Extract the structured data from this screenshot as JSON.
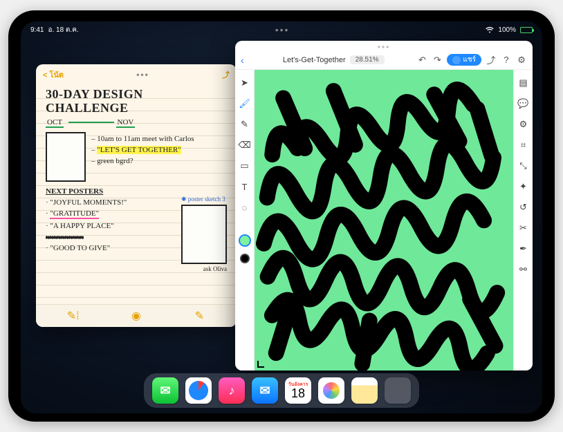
{
  "status": {
    "time": "9:41",
    "date": "อ. 18 ต.ค.",
    "battery_pct": "100%"
  },
  "notes": {
    "header": {
      "title": "โน้ต"
    },
    "title_line1": "30-DAY DESIGN",
    "title_line2": "CHALLENGE",
    "month_from": "OCT",
    "month_to": "NOV",
    "bullets1": {
      "a": "10am to 11am meet with Carlos",
      "b": "\"LET'S GET TOGETHER\"",
      "c": "green bgrd?"
    },
    "heading_next": "NEXT POSTERS",
    "list": {
      "a": "\"JOYFUL MOMENTS!\"",
      "b": "\"GRATITUDE\"",
      "c": "\"A HAPPY PLACE\"",
      "d": "xxxxxxxxxx",
      "e": "\"GOOD TO GIVE\""
    },
    "sketch_label": "poster sketch 3",
    "sketch_footer": "ask Oliva"
  },
  "design": {
    "title": "Let's-Get-Together",
    "zoom": "28.51%",
    "share_label": "แชร์"
  },
  "calendar": {
    "dow": "วันอังคาร",
    "day": "18"
  }
}
